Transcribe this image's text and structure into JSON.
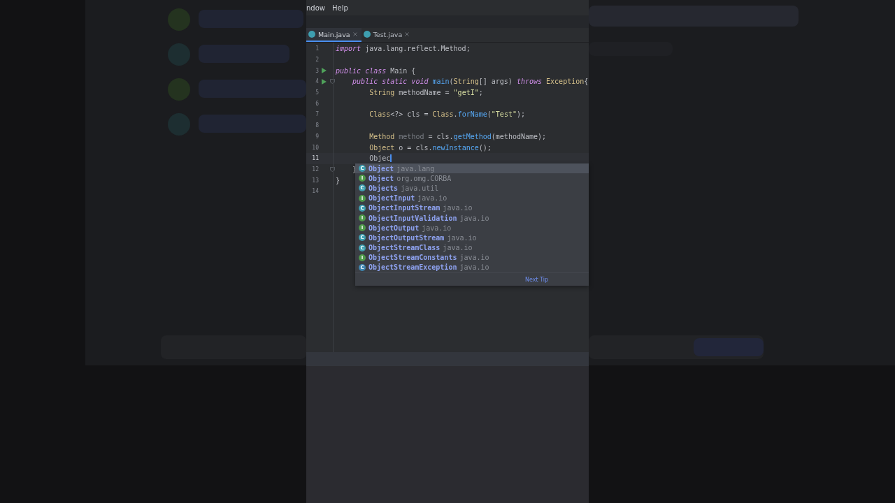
{
  "menu": [
    "ndow",
    "Help"
  ],
  "tabs": [
    {
      "label": "Main.java",
      "selected": true
    },
    {
      "label": "Test.java",
      "selected": false
    }
  ],
  "code": [
    {
      "number": "1",
      "tokens": [
        {
          "text": "import",
          "kind": "keyword"
        },
        {
          "text": " java.lang.reflect.Method;",
          "kind": "plain"
        }
      ]
    },
    {
      "number": "2"
    },
    {
      "number": "3",
      "run": true,
      "tokens": [
        {
          "text": "public class",
          "kind": "keyword"
        },
        {
          "text": " Main {",
          "kind": "plain"
        }
      ]
    },
    {
      "number": "4",
      "run": true,
      "fold": true,
      "tokens": [
        {
          "text": "    public static void",
          "kind": "keyword"
        },
        {
          "text": " main",
          "kind": "method"
        },
        {
          "text": "(",
          "kind": "plain"
        },
        {
          "text": "String",
          "kind": "type"
        },
        {
          "text": "[] args) ",
          "kind": "plain"
        },
        {
          "text": "throws",
          "kind": "keyword"
        },
        {
          "text": " Exception",
          "kind": "type"
        },
        {
          "text": "{",
          "kind": "plain"
        }
      ]
    },
    {
      "number": "5",
      "tokens": [
        {
          "text": "        String",
          "kind": "type"
        },
        {
          "text": " methodName = ",
          "kind": "plain"
        },
        {
          "text": "\"getI\"",
          "kind": "string"
        },
        {
          "text": ";",
          "kind": "plain"
        }
      ]
    },
    {
      "number": "6"
    },
    {
      "number": "7",
      "tokens": [
        {
          "text": "        Class",
          "kind": "type"
        },
        {
          "text": "<?> cls = ",
          "kind": "plain"
        },
        {
          "text": "Class",
          "kind": "type"
        },
        {
          "text": ".",
          "kind": "plain"
        },
        {
          "text": "forName",
          "kind": "method"
        },
        {
          "text": "(",
          "kind": "plain"
        },
        {
          "text": "\"Test\"",
          "kind": "string"
        },
        {
          "text": ");",
          "kind": "plain"
        }
      ]
    },
    {
      "number": "8"
    },
    {
      "number": "9",
      "tokens": [
        {
          "text": "        Method",
          "kind": "type"
        },
        {
          "text": " method",
          "kind": "unused"
        },
        {
          "text": " = cls.",
          "kind": "plain"
        },
        {
          "text": "getMethod",
          "kind": "method"
        },
        {
          "text": "(methodName);",
          "kind": "plain"
        }
      ]
    },
    {
      "number": "10",
      "tokens": [
        {
          "text": "        Object",
          "kind": "type"
        },
        {
          "text": " o = cls.",
          "kind": "plain"
        },
        {
          "text": "newInstance",
          "kind": "method"
        },
        {
          "text": "();",
          "kind": "plain"
        }
      ]
    },
    {
      "number": "11",
      "current": true,
      "caret": true,
      "tokens": [
        {
          "text": "        Objec",
          "kind": "plain"
        }
      ]
    },
    {
      "number": "12",
      "fold": true,
      "tokens": [
        {
          "text": "    }",
          "kind": "plain"
        }
      ]
    },
    {
      "number": "13",
      "tokens": [
        {
          "text": "}",
          "kind": "plain"
        }
      ]
    },
    {
      "number": "14"
    }
  ],
  "completion": {
    "items": [
      {
        "badge": "C",
        "kind": "class",
        "name": "Object",
        "package": "java.lang",
        "selected": true
      },
      {
        "badge": "I",
        "kind": "interface",
        "name": "Object",
        "package": "org.omg.CORBA",
        "selected": false
      },
      {
        "badge": "C",
        "kind": "class",
        "name": "Objects",
        "package": "java.util",
        "selected": false
      },
      {
        "badge": "I",
        "kind": "interface",
        "name": "ObjectInput",
        "package": "java.io",
        "selected": false
      },
      {
        "badge": "C",
        "kind": "class",
        "name": "ObjectInputStream",
        "package": "java.io",
        "selected": false
      },
      {
        "badge": "I",
        "kind": "interface",
        "name": "ObjectInputValidation",
        "package": "java.io",
        "selected": false
      },
      {
        "badge": "I",
        "kind": "interface",
        "name": "ObjectOutput",
        "package": "java.io",
        "selected": false
      },
      {
        "badge": "C",
        "kind": "class",
        "name": "ObjectOutputStream",
        "package": "java.io",
        "selected": false
      },
      {
        "badge": "C",
        "kind": "class",
        "name": "ObjectStreamClass",
        "package": "java.io",
        "selected": false
      },
      {
        "badge": "I",
        "kind": "interface",
        "name": "ObjectStreamConstants",
        "package": "java.io",
        "selected": false
      },
      {
        "badge": "C",
        "kind": "exception",
        "name": "ObjectStreamException",
        "package": "java.io",
        "selected": false
      }
    ],
    "footer_link": "Next Tip"
  }
}
